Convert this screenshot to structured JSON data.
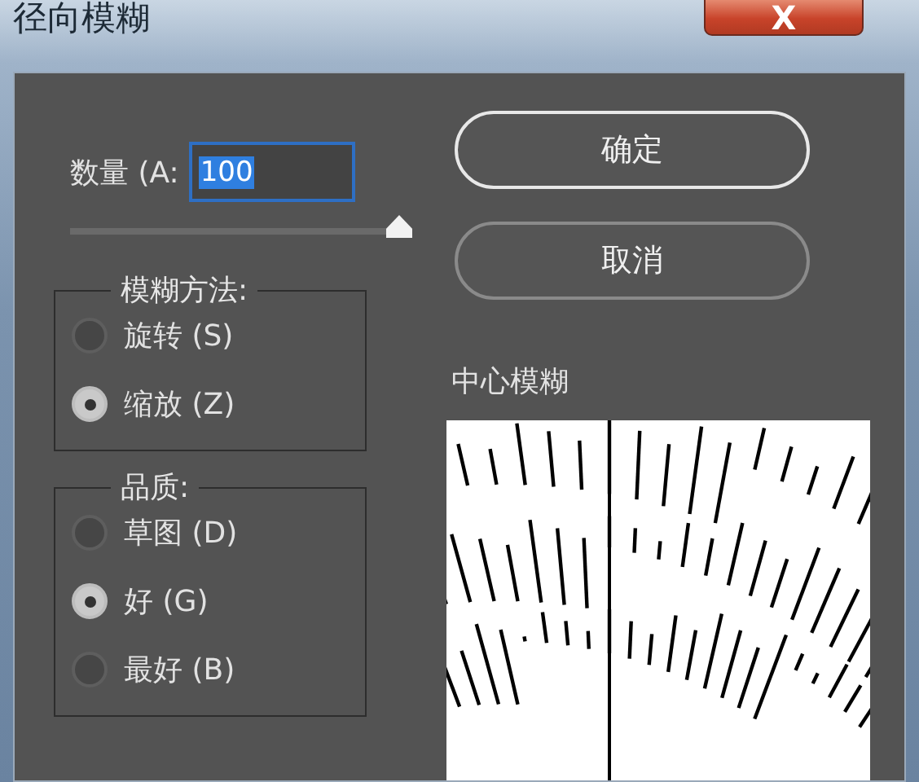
{
  "window": {
    "title": "径向模糊",
    "close": "X"
  },
  "amount": {
    "label": "数量 (A:",
    "value": "100",
    "level": 1.0
  },
  "buttons": [
    {
      "label": "确定",
      "default": true
    },
    {
      "label": "取消",
      "default": false
    }
  ],
  "groups": [
    {
      "title": "模糊方法:",
      "options": [
        {
          "label": "旋转 (S)",
          "selected": false
        },
        {
          "label": "缩放 (Z)",
          "selected": true
        }
      ]
    },
    {
      "title": "品质:",
      "options": [
        {
          "label": "草图 (D)",
          "selected": false
        },
        {
          "label": "好 (G)",
          "selected": true
        },
        {
          "label": "最好 (B)",
          "selected": false
        }
      ]
    }
  ],
  "preview": {
    "label": "中心模糊",
    "kind": "picture"
  }
}
